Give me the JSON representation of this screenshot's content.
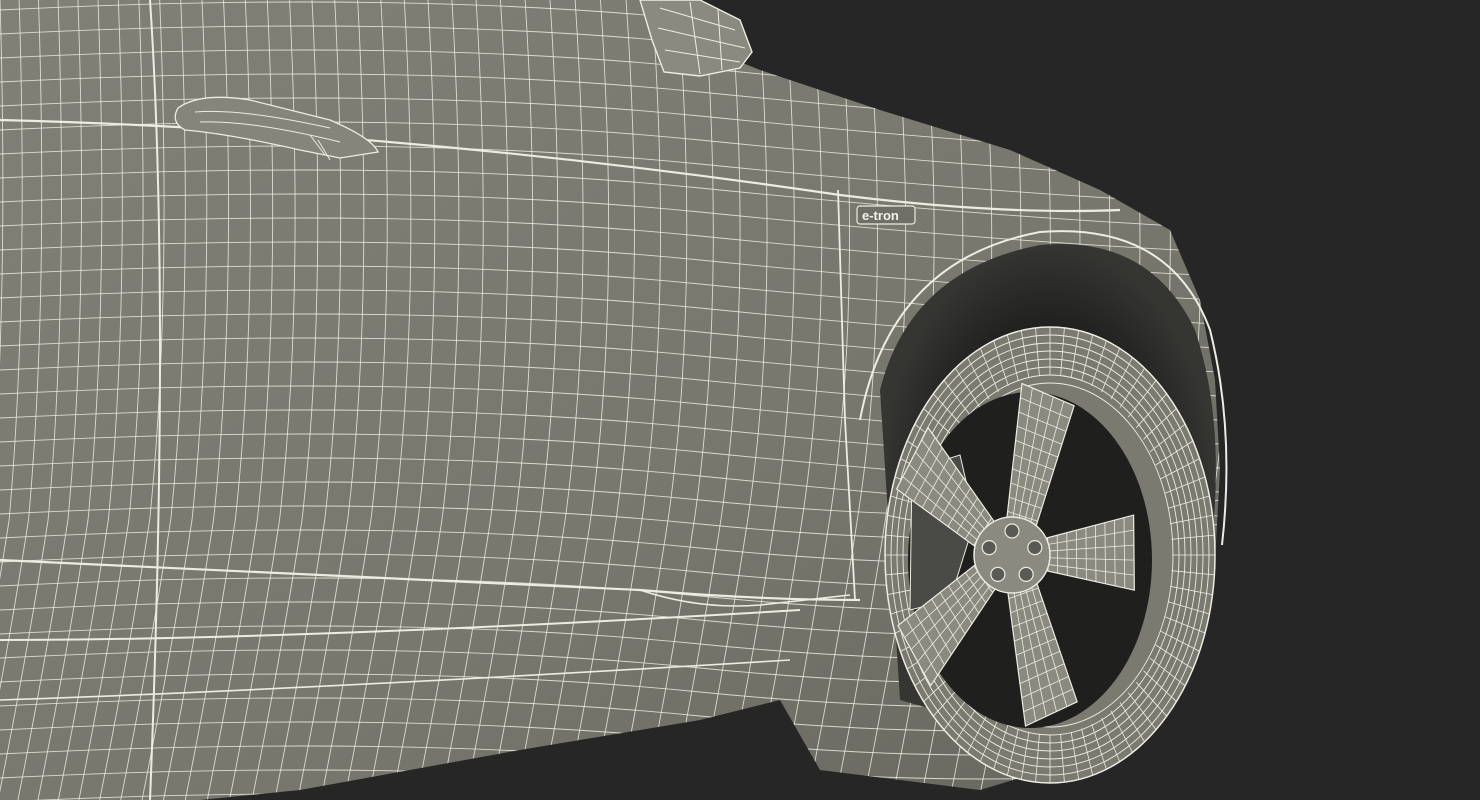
{
  "scene": {
    "subject": "car",
    "render_style": "wireframe",
    "colors": {
      "background": "#262626",
      "body_fill": "#7b7b72",
      "body_shade": "#6b6b63",
      "wire": "#ecece2",
      "tire_shadow": "#2c2c2a",
      "rim_fill": "#8a8a80",
      "brake": "#4a4a46"
    }
  },
  "badge": {
    "text": "e-tron"
  }
}
